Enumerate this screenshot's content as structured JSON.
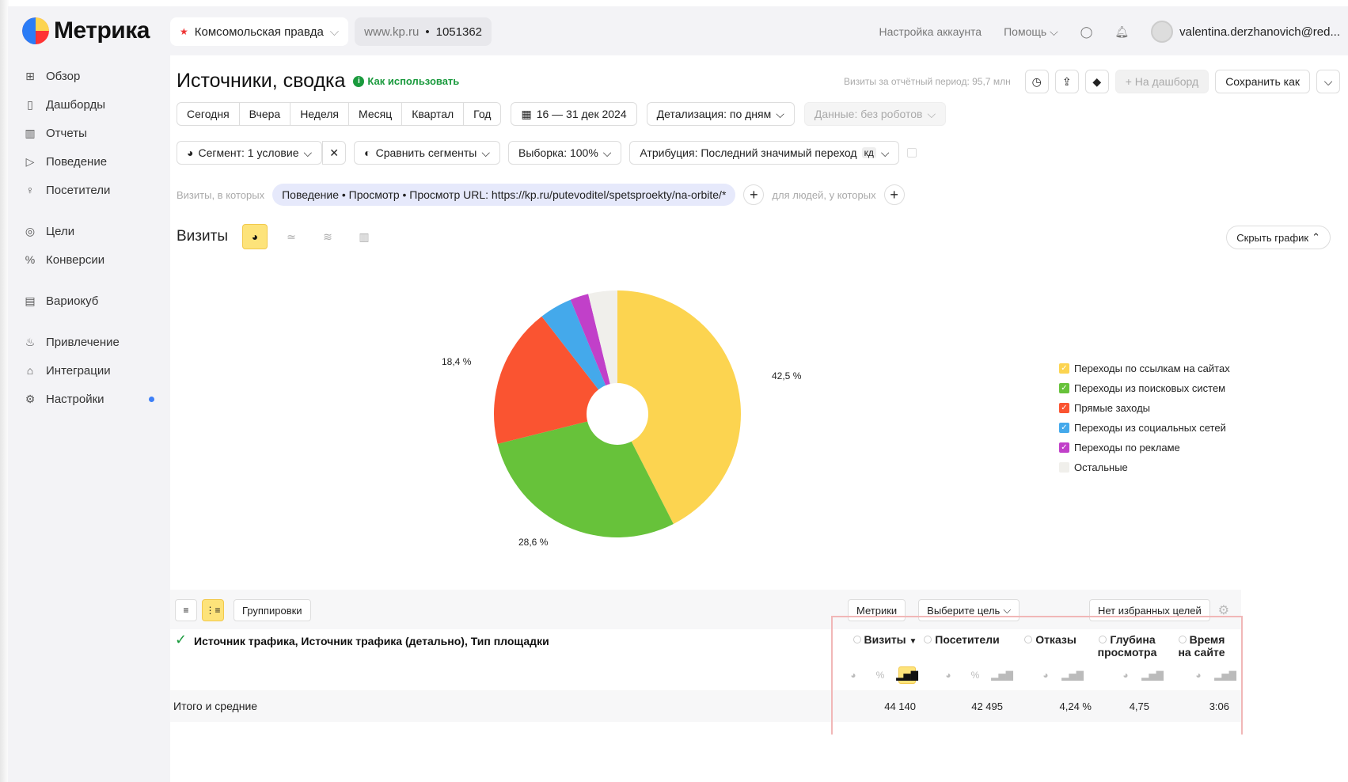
{
  "app": {
    "logo_text": "Метрика",
    "counter_name": "Комсомольская правда",
    "site": "www.kp.ru",
    "counter_id": "1051362",
    "account_settings": "Настройка аккаунта",
    "help": "Помощь",
    "user_email": "valentina.derzhanovich@red..."
  },
  "sidebar": {
    "items": [
      {
        "label": "Обзор",
        "icon": "grid-icon"
      },
      {
        "label": "Дашборды",
        "icon": "dashboard-icon"
      },
      {
        "label": "Отчеты",
        "icon": "reports-icon"
      },
      {
        "label": "Поведение",
        "icon": "play-icon"
      },
      {
        "label": "Посетители",
        "icon": "person-icon"
      },
      {
        "label": "Цели",
        "icon": "target-icon"
      },
      {
        "label": "Конверсии",
        "icon": "percent-icon"
      },
      {
        "label": "Вариокуб",
        "icon": "cube-icon"
      },
      {
        "label": "Привлечение",
        "icon": "fire-icon"
      },
      {
        "label": "Интеграции",
        "icon": "integration-icon"
      },
      {
        "label": "Настройки",
        "icon": "gear-icon"
      }
    ]
  },
  "header": {
    "title": "Источники, сводка",
    "how_to": "Как использовать",
    "visits_total": "Визиты за отчётный период: 95,7 млн",
    "to_dashboard": "+ На дашборд",
    "save_as": "Сохранить как"
  },
  "periods": [
    "Сегодня",
    "Вчера",
    "Неделя",
    "Месяц",
    "Квартал",
    "Год"
  ],
  "date_range": "16 — 31 дек 2024",
  "detail": "Детализация: по дням",
  "data_mode": "Данные: без роботов",
  "segment": "Сегмент: 1 условие",
  "compare": "Сравнить сегменты",
  "sample": "Выборка: 100%",
  "attribution": "Атрибуция: Последний значимый переход",
  "attribution_badge": "кд",
  "filter": {
    "prefix": "Визиты, в которых",
    "chip": "Поведение • Просмотр • Просмотр URL: https://kp.ru/putevoditel/spetsproekty/na-orbite/*",
    "people": "для людей, у которых"
  },
  "chart_header": {
    "title": "Визиты",
    "hide": "Скрыть график"
  },
  "chart_data": {
    "type": "pie",
    "title": "Визиты",
    "donut": true,
    "series": [
      {
        "name": "Переходы по ссылкам на сайтах",
        "value": 42.5,
        "color": "#fcd450"
      },
      {
        "name": "Переходы из поисковых систем",
        "value": 28.6,
        "color": "#67c23a"
      },
      {
        "name": "Прямые заходы",
        "value": 18.4,
        "color": "#fa5431"
      },
      {
        "name": "Переходы из социальных сетей",
        "value": 4.3,
        "color": "#44a9eb"
      },
      {
        "name": "Переходы по рекламе",
        "value": 2.4,
        "color": "#c140c9"
      },
      {
        "name": "Остальные",
        "value": 3.8,
        "color": "#f0efeb"
      }
    ],
    "data_labels": [
      "42,5 %",
      "28,6 %",
      "18,4 %"
    ]
  },
  "table": {
    "groupings": "Группировки",
    "metrics_btn": "Метрики",
    "choose_goal": "Выберите цель",
    "no_fav_goals": "Нет избранных целей",
    "dimension": "Источник трафика, Источник трафика (детально), Тип площадки",
    "totals_label": "Итого и средние",
    "metrics": [
      {
        "name": "Визиты",
        "sort": "▼",
        "total": "44 140"
      },
      {
        "name": "Посетители",
        "total": "42 495"
      },
      {
        "name": "Отказы",
        "total": "4,24 %"
      },
      {
        "name": "Глубина просмотра",
        "total": "4,75"
      },
      {
        "name": "Время на сайте",
        "total": "3:06"
      }
    ]
  }
}
